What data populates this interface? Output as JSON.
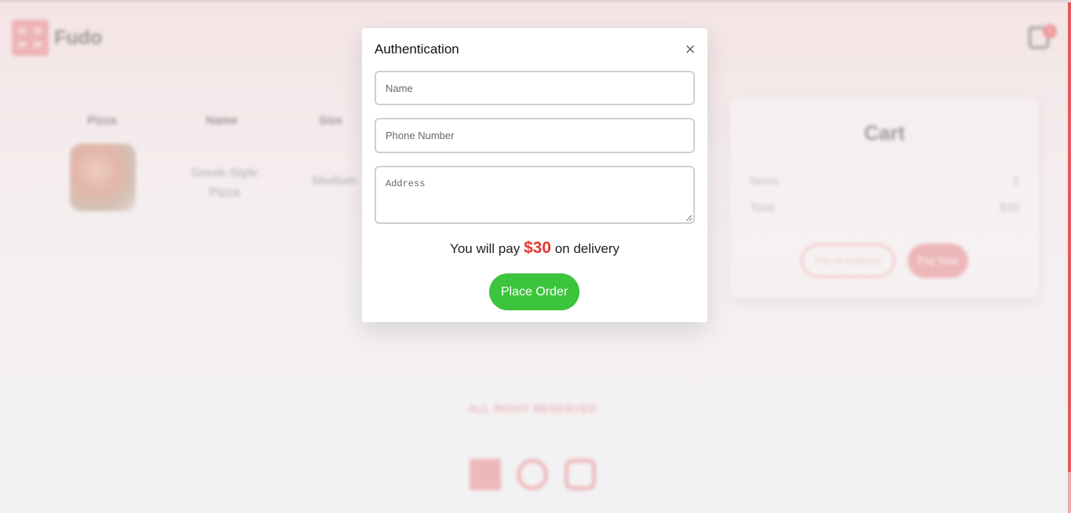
{
  "header": {
    "logo_text": "Fudo",
    "cart_count": "1"
  },
  "table": {
    "headers": [
      "Pizza",
      "Name",
      "Size"
    ],
    "rows": [
      {
        "name": "Greek-Style Pizza",
        "size": "Medium"
      }
    ]
  },
  "cart": {
    "title": "Cart",
    "items_label": "Items",
    "items_value": "1",
    "total_label": "Total",
    "total_value": "$30",
    "pay_on_delivery_label": "Pay on Delivery",
    "pay_now_label": "Pay Now"
  },
  "footer": {
    "rights": "ALL RIGHT RESERVED",
    "social_icons": [
      "facebook-icon",
      "github-icon",
      "instagram-icon"
    ]
  },
  "modal": {
    "title": "Authentication",
    "close_icon": "close-icon",
    "name_placeholder": "Name",
    "phone_placeholder": "Phone Number",
    "address_placeholder": "Address",
    "pay_prefix": "You will pay",
    "pay_amount": "$30",
    "pay_suffix": "on delivery",
    "place_order_label": "Place Order"
  },
  "colors": {
    "accent": "#e7595c",
    "accent_light": "#e98a8d",
    "success": "#3cc43c",
    "price": "#e53935"
  }
}
